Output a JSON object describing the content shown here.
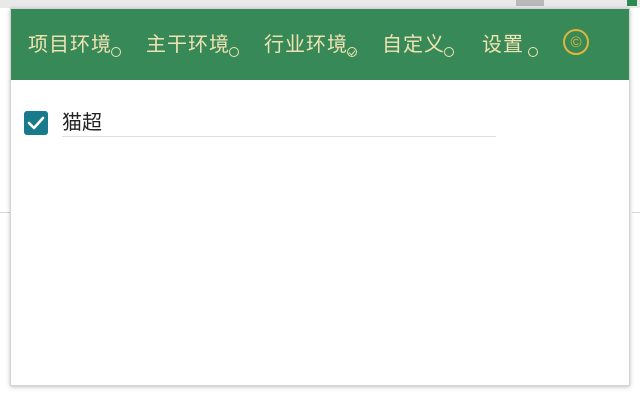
{
  "nav": {
    "items": [
      {
        "label": "项目环境",
        "selected": false
      },
      {
        "label": "主干环境",
        "selected": false
      },
      {
        "label": "行业环境",
        "selected": true
      },
      {
        "label": "自定义",
        "selected": false
      },
      {
        "label": "设置",
        "selected": false
      }
    ],
    "copyright_symbol": "©"
  },
  "list": {
    "items": [
      {
        "label": "猫超",
        "checked": true
      }
    ]
  },
  "colors": {
    "navbar_bg": "#378a57",
    "nav_text": "#f1e2b3",
    "copyright_icon": "#e3b43a",
    "checkbox_bg": "#187a8a"
  },
  "icons": {
    "radio_unchecked": "radio-unchecked-icon",
    "radio_checked": "radio-checked-icon",
    "copyright": "copyright-icon",
    "checkmark": "checkmark-icon"
  }
}
